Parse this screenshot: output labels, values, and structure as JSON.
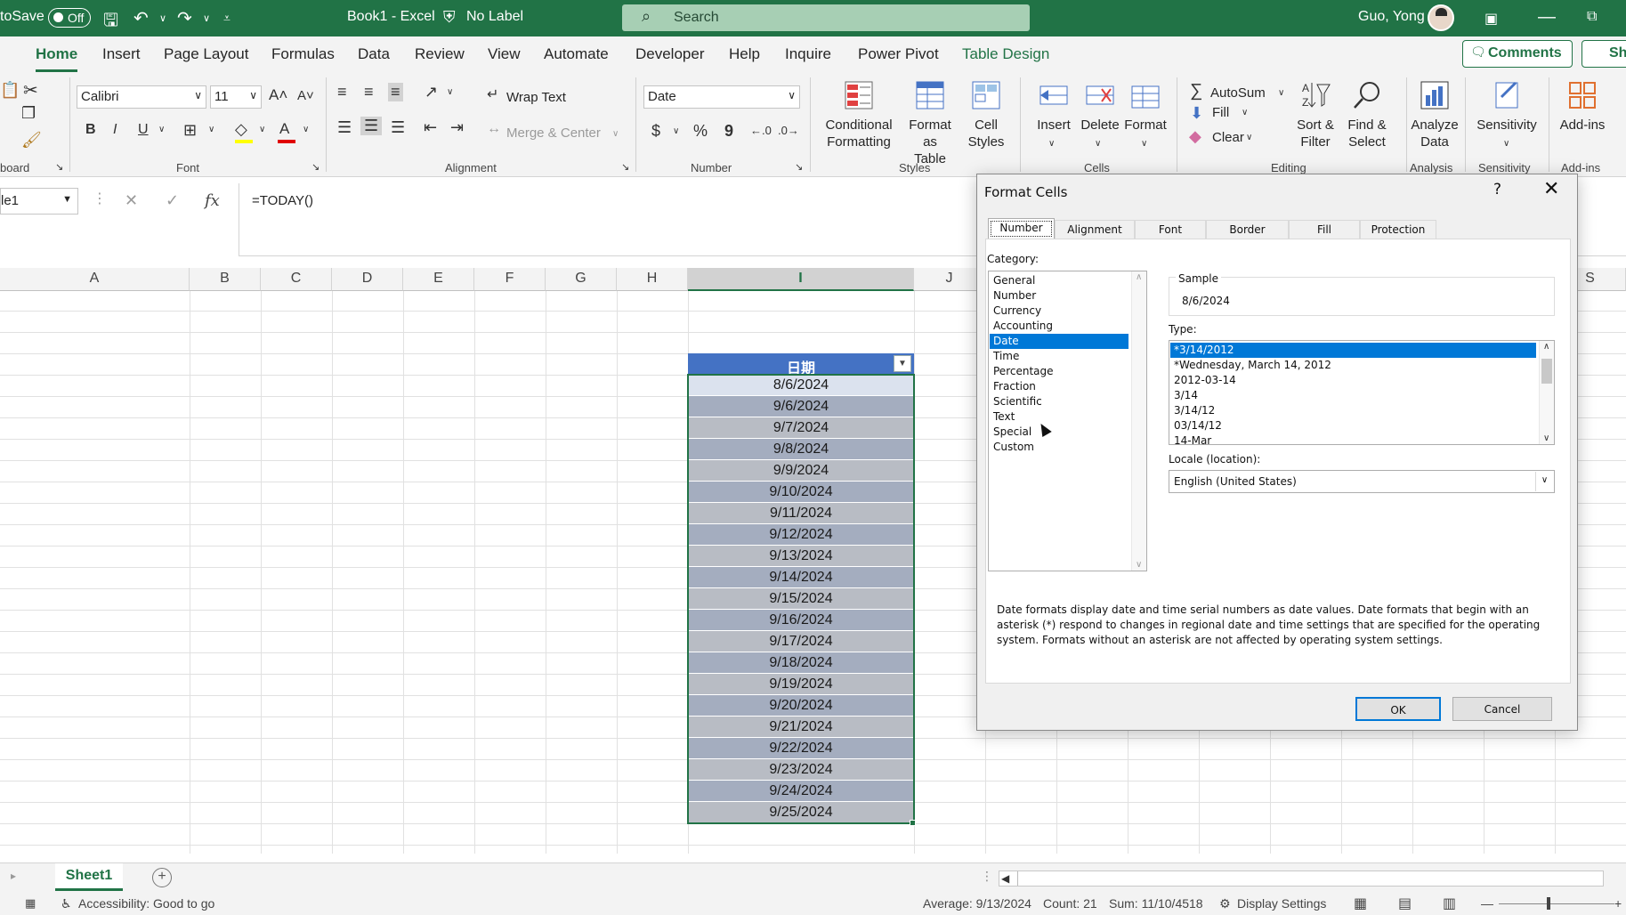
{
  "titlebar": {
    "autosave_label": "toSave",
    "autosave_state": "Off",
    "doc_title": "Book1  -  Excel",
    "sensitivity_label": "No Label",
    "search_placeholder": "Search",
    "user_name": "Guo, Yong"
  },
  "ribbon_tabs": [
    "Home",
    "Insert",
    "Page Layout",
    "Formulas",
    "Data",
    "Review",
    "View",
    "Automate",
    "Developer",
    "Help",
    "Inquire",
    "Power Pivot",
    "Table Design"
  ],
  "comments_label": "Comments",
  "share_label": "Sh",
  "ribbon": {
    "font_name": "Calibri",
    "font_size": "11",
    "bold": "B",
    "italic": "I",
    "underline": "U",
    "wrap_text": "Wrap Text",
    "merge_center": "Merge & Center",
    "number_format": "Date",
    "currency_symbol": "$",
    "percent_symbol": "%",
    "comma_symbol": "9",
    "cond_formatting": "Conditional\nFormatting",
    "format_as_table": "Format as\nTable",
    "cell_styles": "Cell\nStyles",
    "insert": "Insert",
    "delete": "Delete",
    "format": "Format",
    "autosum": "AutoSum",
    "fill": "Fill",
    "clear": "Clear",
    "sort_filter": "Sort &\nFilter",
    "find_select": "Find &\nSelect",
    "analyze_data": "Analyze\nData",
    "sensitivity": "Sensitivity",
    "addins": "Add-ins",
    "groups": {
      "clipboard": "board",
      "font": "Font",
      "alignment": "Alignment",
      "number": "Number",
      "styles": "Styles",
      "cells": "Cells",
      "editing": "Editing",
      "analysis": "Analysis",
      "sensitivity": "Sensitivity",
      "addins": "Add-ins"
    }
  },
  "formula_bar": {
    "name_box": "le1",
    "formula": "=TODAY()"
  },
  "columns": [
    "A",
    "B",
    "C",
    "D",
    "E",
    "F",
    "G",
    "H",
    "I",
    "J",
    "S"
  ],
  "table": {
    "header": "日期",
    "rows": [
      "8/6/2024",
      "9/6/2024",
      "9/7/2024",
      "9/8/2024",
      "9/9/2024",
      "9/10/2024",
      "9/11/2024",
      "9/12/2024",
      "9/13/2024",
      "9/14/2024",
      "9/15/2024",
      "9/16/2024",
      "9/17/2024",
      "9/18/2024",
      "9/19/2024",
      "9/20/2024",
      "9/21/2024",
      "9/22/2024",
      "9/23/2024",
      "9/24/2024",
      "9/25/2024"
    ]
  },
  "sheet_tab": "Sheet1",
  "statusbar": {
    "accessibility": "Accessibility: Good to go",
    "average": "Average: 9/13/2024",
    "count": "Count: 21",
    "sum": "Sum: 11/10/4518",
    "display_settings": "Display Settings"
  },
  "dialog": {
    "title": "Format Cells",
    "help": "?",
    "close": "✕",
    "tabs": [
      "Number",
      "Alignment",
      "Font",
      "Border",
      "Fill",
      "Protection"
    ],
    "category_label": "Category:",
    "categories": [
      "General",
      "Number",
      "Currency",
      "Accounting",
      "Date",
      "Time",
      "Percentage",
      "Fraction",
      "Scientific",
      "Text",
      "Special",
      "Custom"
    ],
    "selected_category": "Date",
    "sample_label": "Sample",
    "sample_value": "8/6/2024",
    "type_label": "Type:",
    "types": [
      "*3/14/2012",
      "*Wednesday, March 14, 2012",
      "2012-03-14",
      "3/14",
      "3/14/12",
      "03/14/12",
      "14-Mar"
    ],
    "locale_label": "Locale (location):",
    "locale_value": "English (United States)",
    "description": "Date formats display date and time serial numbers as date values.  Date formats that begin with an asterisk (*) respond to changes in regional date and time settings that are specified for the operating system. Formats without an asterisk are not affected by operating system settings.",
    "ok": "OK",
    "cancel": "Cancel"
  }
}
